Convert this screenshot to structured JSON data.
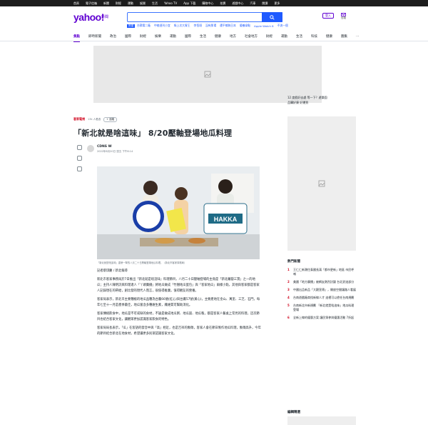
{
  "topbar": [
    "首頁",
    "電子信箱",
    "新聞",
    "財經",
    "運動",
    "娛樂",
    "生活",
    "Yahoo TV",
    "App 下載",
    "購物中心",
    "拍賣",
    "遊戲中心",
    "汽車",
    "閱讀",
    "更多"
  ],
  "header": {
    "logo": "yahoo!",
    "logo_sub": "新聞",
    "search_placeholder": "",
    "login": "登入",
    "mail": "信箱"
  },
  "trending": {
    "tag": "熱搜",
    "items": [
      "台積電二廠",
      "中綾週刊小宜",
      "綠上次大胃王",
      "李恆翊",
      "沒有那場",
      "遭平躺狗日本",
      "優養拿點",
      "Apple Watch 8",
      "不流一個"
    ]
  },
  "nav": {
    "active": "焦點",
    "items": [
      "焦點",
      "即時新聞",
      "政治",
      "國際",
      "財經",
      "娛樂",
      "運動",
      "國際",
      "生活",
      "健康",
      "地方",
      "社會地方",
      "財經",
      "運動",
      "生活",
      "科技",
      "健康",
      "圖集",
      "…"
    ]
  },
  "article": {
    "source": "客家電視",
    "meta": "13k 人看過",
    "follow": "+ 追蹤",
    "title": "「新北就是啥這味」 8/20壓軸登場地瓜料理",
    "author": "CDNS W",
    "date": "2022年8月20日 週五 下午8:14",
    "caption": "「新北就是啥這味」重磅一擊的八月二十日壓軸登場地瓜料理。（新北市客家事務局）",
    "paragraphs": [
      "記者蔡琪慶 / 新北報導",
      "新北市客家事務局於7日推出「新北就是啥這味」料理節目，八月二十日壓軸登場的主角是「新北蘿蔔三寶」之一的地瓜；主持人陳明詩與料理達人「丫頭廣播」將地瓜做成「竹翹地瓜蛋包」與「客家地瓜」兩樣小點，其他與客家都是客家人記錄現在的帶給，創比發的現代人而言，很值得推廣，值得觀友的營養。",
      "客家局表示，新北市主要種植的地瓜品種為台農66號(紅心)與台農57號(黃心)，主要產地在金山、萬里、三芝、石門，每年七至十一月是產季最佳，地瓜富含多種維生素，纖維質可幫助消化。",
      "客家傳統飲食中，地瓜是不可或缺的食材，不論是做成地瓜粥、地瓜圓、地瓜粄，都是客家人餐桌上常見的料理，這次節目也結合客家文化，讓觀眾更加認識客家飲食的特色。",
      "客家局局長表示，「瓜」在客語的發音中與「高」相近，也是吉祥的象徵，客家人會在節日製作地瓜料理，象徵高升，今年的節目結合新北在地食材，希望讓更多民眾認識客家文化。"
    ]
  },
  "right": {
    "promo": [
      "12 度假好去處 等一下？遊樂園",
      "品購好康 好運到"
    ],
    "hot_title": "熱門新聞",
    "hot": [
      "王仁仁新潮住泰國長滿「都市更新」地區 市民呼喊",
      "美國「地方廣播」被網友熱烈討論 台北對這部分",
      "中國出品新品「大觀宣傳」，開放空間讓路人看展",
      "台南遊戲廠商找新線人才 這裡可以擔任台南規劃",
      "台南新北市新規劃 「新北就是啥這味」地瓜料理登場",
      "全新上線的優惠方案 讓民眾參與優惠活動 7折起"
    ],
    "editor_title": "編輯精選"
  },
  "colors": {
    "brand": "#6001d2",
    "search": "#1f5aff",
    "source": "#d0021b"
  }
}
